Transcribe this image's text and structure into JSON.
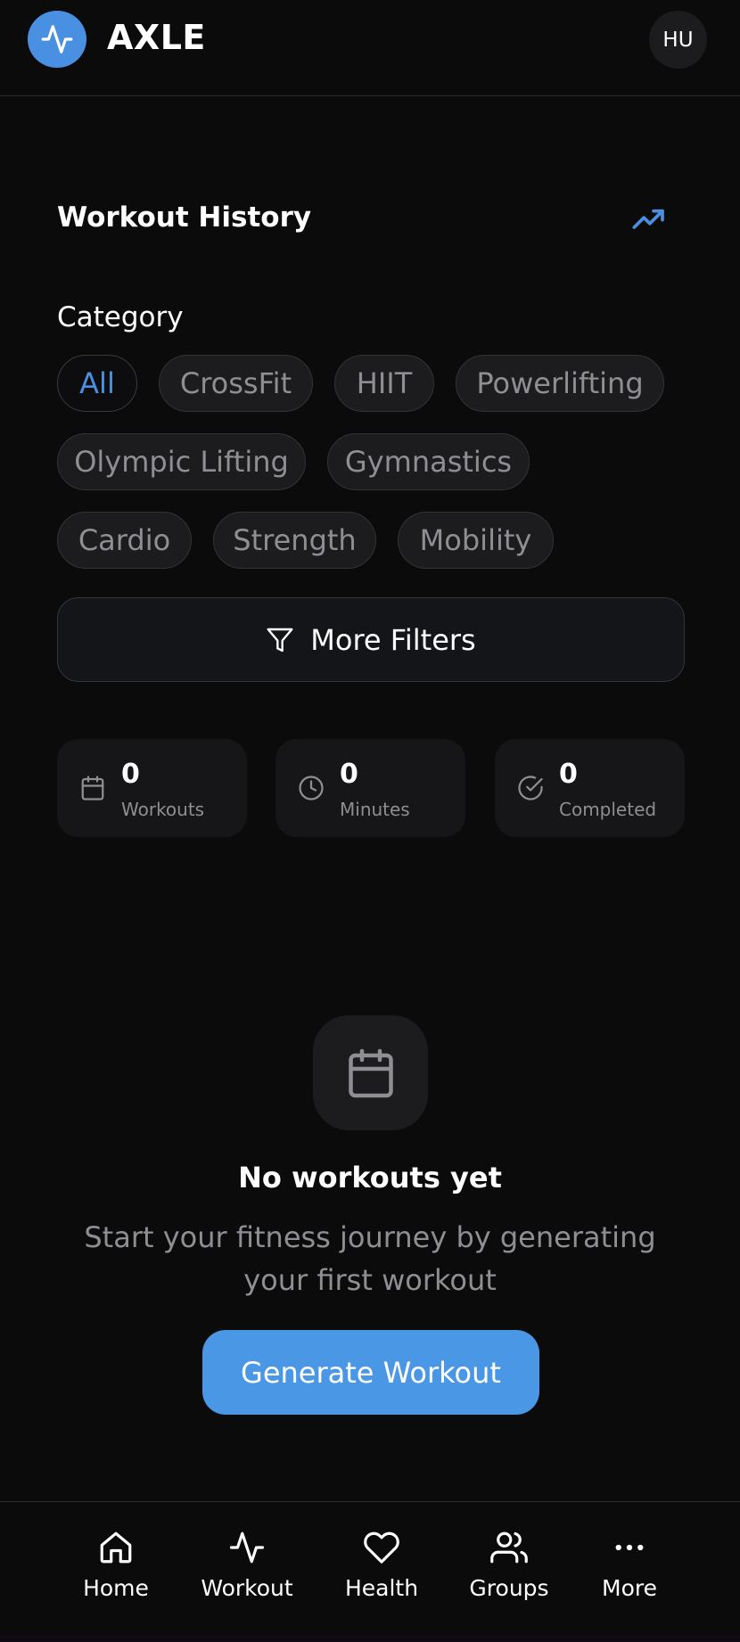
{
  "header": {
    "brand": "AXLE",
    "avatar_initials": "HU"
  },
  "section": {
    "title": "Workout History"
  },
  "filters": {
    "category_label": "Category",
    "chips": [
      "All",
      "CrossFit",
      "HIIT",
      "Powerlifting",
      "Olympic Lifting",
      "Gymnastics",
      "Cardio",
      "Strength",
      "Mobility"
    ],
    "selected": "All",
    "more_filters_label": "More Filters"
  },
  "stats": [
    {
      "value": "0",
      "label": "Workouts",
      "icon": "calendar-icon"
    },
    {
      "value": "0",
      "label": "Minutes",
      "icon": "clock-icon"
    },
    {
      "value": "0",
      "label": "Completed",
      "icon": "check-circle-icon"
    }
  ],
  "empty_state": {
    "title": "No workouts yet",
    "text": "Start your fitness journey by generating your first workout",
    "button_label": "Generate Workout"
  },
  "bottom_nav": [
    {
      "label": "Home",
      "icon": "home-icon"
    },
    {
      "label": "Workout",
      "icon": "activity-icon"
    },
    {
      "label": "Health",
      "icon": "heart-icon"
    },
    {
      "label": "Groups",
      "icon": "users-icon"
    },
    {
      "label": "More",
      "icon": "more-icon"
    }
  ],
  "colors": {
    "accent": "#4a90e2",
    "background": "#0b0b0c",
    "card": "#161618",
    "muted_text": "#8e8e93"
  }
}
